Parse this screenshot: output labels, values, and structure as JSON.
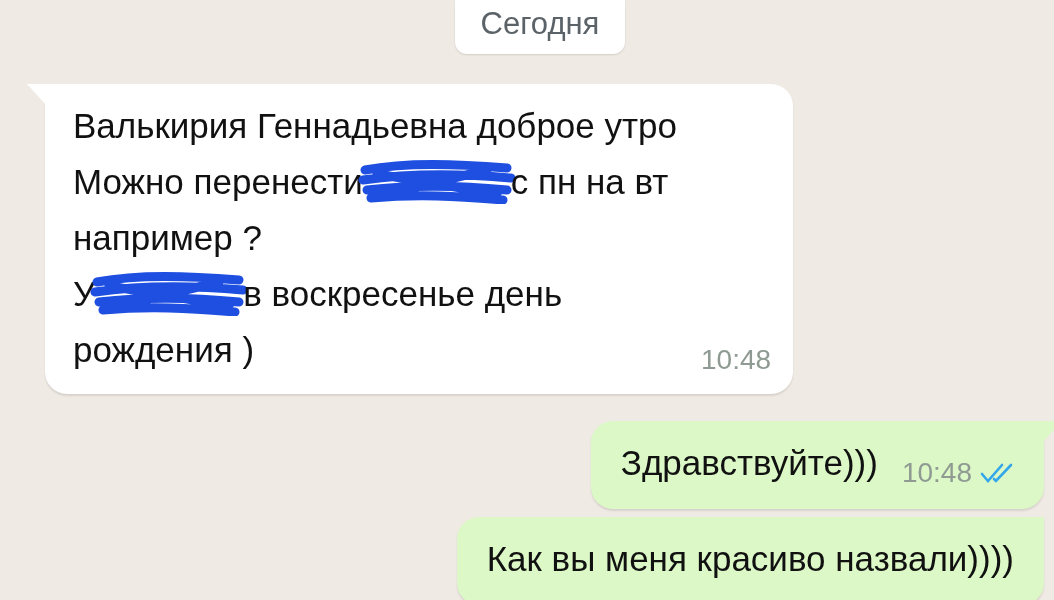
{
  "date_chip": "Сегодня",
  "messages": [
    {
      "kind": "incoming",
      "time": "10:48",
      "lines": [
        [
          {
            "kind": "text",
            "text": "Валькирия Геннадьевна доброе утро"
          }
        ],
        [
          {
            "kind": "text",
            "text": "Можно перенести"
          },
          {
            "kind": "scribble"
          },
          {
            "kind": "text",
            "text": "с пн на вт"
          }
        ],
        [
          {
            "kind": "text",
            "text": "например ?"
          }
        ],
        [
          {
            "kind": "text",
            "text": "У"
          },
          {
            "kind": "scribble"
          },
          {
            "kind": "text",
            "text": "в воскресенье день"
          }
        ],
        [
          {
            "kind": "text",
            "text": "рождения )"
          }
        ]
      ]
    },
    {
      "kind": "outgoing",
      "time": "10:48",
      "read": true,
      "lines": [
        [
          {
            "kind": "text",
            "text": "Здравствуйте)))"
          }
        ]
      ]
    },
    {
      "kind": "outgoing",
      "lines": [
        [
          {
            "kind": "text",
            "text": "Как вы меня красиво назвали))))"
          }
        ]
      ]
    }
  ]
}
